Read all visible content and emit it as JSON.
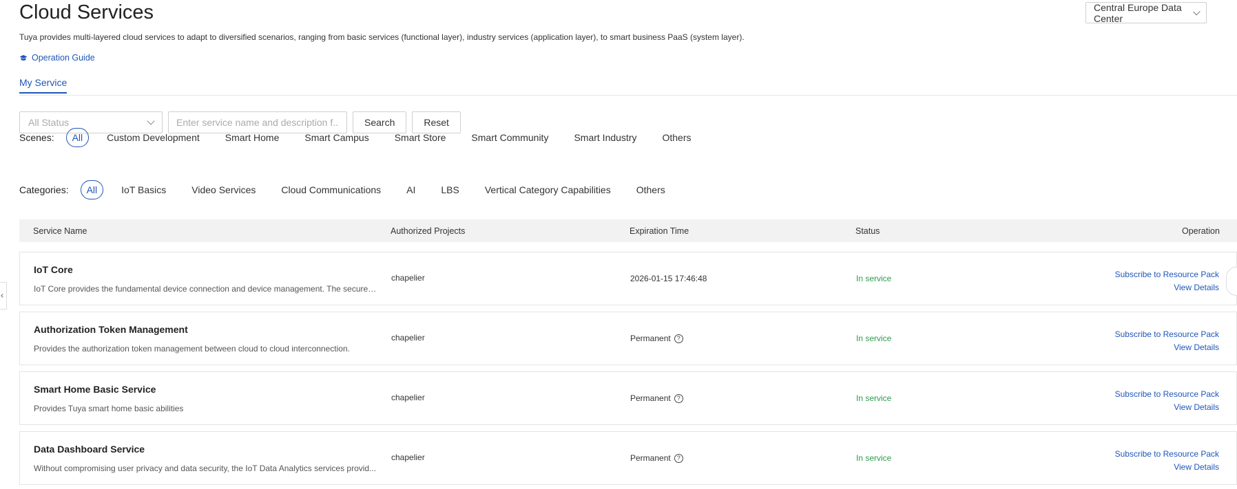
{
  "header": {
    "title": "Cloud Services",
    "region": "Central Europe Data Center",
    "description": "Tuya provides multi-layered cloud services to adapt to diversified scenarios, ranging from basic services (functional layer), industry services (application layer), to smart business PaaS (system layer).",
    "guide_label": "Operation Guide"
  },
  "tabs": {
    "active": "My Service"
  },
  "filters": {
    "status_placeholder": "All Status",
    "search_placeholder": "Enter service name and description f...",
    "search_label": "Search",
    "reset_label": "Reset"
  },
  "scenes": {
    "label": "Scenes:",
    "items": [
      "All",
      "Custom Development",
      "Smart Home",
      "Smart Campus",
      "Smart Store",
      "Smart Community",
      "Smart Industry",
      "Others"
    ]
  },
  "categories": {
    "label": "Categories:",
    "items": [
      "All",
      "IoT Basics",
      "Video Services",
      "Cloud Communications",
      "AI",
      "LBS",
      "Vertical Category Capabilities",
      "Others"
    ]
  },
  "table": {
    "columns": [
      "Service Name",
      "Authorized Projects",
      "Expiration Time",
      "Status",
      "Operation"
    ],
    "rows": [
      {
        "name": "IoT Core",
        "desc": "IoT Core provides the fundamental device connection and device management. The secured ...",
        "project": "chapelier",
        "expiration": "2026-01-15 17:46:48",
        "permanent": false,
        "status": "In service",
        "op1": "Subscribe to Resource Pack",
        "op2": "View Details"
      },
      {
        "name": "Authorization Token Management",
        "desc": "Provides the authorization token management between cloud to cloud interconnection.",
        "project": "chapelier",
        "expiration": "Permanent",
        "permanent": true,
        "status": "In service",
        "op1": "Subscribe to Resource Pack",
        "op2": "View Details"
      },
      {
        "name": "Smart Home Basic Service",
        "desc": "Provides Tuya smart home basic abilities",
        "project": "chapelier",
        "expiration": "Permanent",
        "permanent": true,
        "status": "In service",
        "op1": "Subscribe to Resource Pack",
        "op2": "View Details"
      },
      {
        "name": "Data Dashboard Service",
        "desc": "Without compromising user privacy and data security, the IoT Data Analytics services provid...",
        "project": "chapelier",
        "expiration": "Permanent",
        "permanent": true,
        "status": "In service",
        "op1": "Subscribe to Resource Pack",
        "op2": "View Details"
      }
    ]
  },
  "colors": {
    "accent": "#1f56b8",
    "success": "#2e9a4e"
  }
}
